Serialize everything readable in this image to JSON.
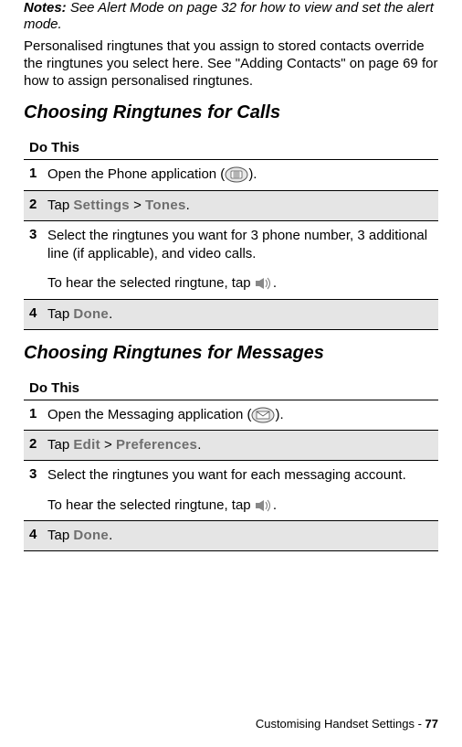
{
  "notes": {
    "label": "Notes:",
    "text": " See Alert Mode on page 32 for how to view and set the alert mode."
  },
  "intro_para": "Personalised ringtunes that you assign to stored contacts override the ringtunes you select here. See \"Adding Contacts\" on page 69 for how to assign personalised ringtunes.",
  "section1": {
    "title": "Choosing Ringtunes for Calls",
    "do_this": "Do This",
    "steps": {
      "s1_num": "1",
      "s1a": "Open the Phone application (",
      "s1b": ").",
      "s2_num": "2",
      "s2a": "Tap ",
      "s2_m1": "Settings",
      "s2b": " > ",
      "s2_m2": "Tones",
      "s2c": ".",
      "s3_num": "3",
      "s3a": "Select the ringtunes you want for 3 phone number, 3 additional line (if applicable), and video calls.",
      "s3b": "To hear the selected ringtune, tap ",
      "s3c": ".",
      "s4_num": "4",
      "s4a": "Tap ",
      "s4_m1": "Done",
      "s4b": "."
    }
  },
  "section2": {
    "title": "Choosing Ringtunes for Messages",
    "do_this": "Do This",
    "steps": {
      "s1_num": "1",
      "s1a": "Open the Messaging application (",
      "s1b": ").",
      "s2_num": "2",
      "s2a": "Tap ",
      "s2_m1": "Edit",
      "s2b": " > ",
      "s2_m2": "Preferences",
      "s2c": ".",
      "s3_num": "3",
      "s3a": "Select the ringtunes you want for each messaging account.",
      "s3b": "To hear the selected ringtune, tap ",
      "s3c": ".",
      "s4_num": "4",
      "s4a": "Tap ",
      "s4_m1": "Done",
      "s4b": "."
    }
  },
  "footer": {
    "text": "Customising Handset Settings - ",
    "page": "77"
  }
}
